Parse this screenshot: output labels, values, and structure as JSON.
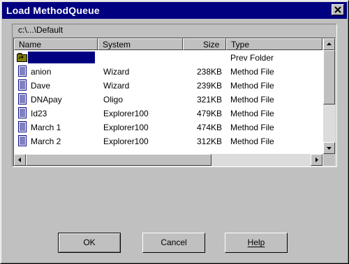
{
  "window": {
    "title": "Load MethodQueue"
  },
  "path_label": "c:\\...\\Default",
  "columns": {
    "name": "Name",
    "system": "System",
    "size": "Size",
    "type": "Type"
  },
  "rows": [
    {
      "name": "",
      "system": "",
      "size": "",
      "type": "Prev Folder",
      "icon": "folder-up-icon",
      "selected": true
    },
    {
      "name": "anion",
      "system": "Wizard",
      "size": "238KB",
      "type": "Method File",
      "icon": "file-icon"
    },
    {
      "name": "Dave",
      "system": "Wizard",
      "size": "239KB",
      "type": "Method File",
      "icon": "file-icon"
    },
    {
      "name": "DNApay",
      "system": "Oligo",
      "size": "321KB",
      "type": "Method File",
      "icon": "file-icon"
    },
    {
      "name": "Id23",
      "system": "Explorer100",
      "size": "479KB",
      "type": "Method File",
      "icon": "file-icon"
    },
    {
      "name": "March 1",
      "system": "Explorer100",
      "size": "474KB",
      "type": "Method File",
      "icon": "file-icon"
    },
    {
      "name": "March 2",
      "system": "Explorer100",
      "size": "312KB",
      "type": "Method File",
      "icon": "file-icon"
    }
  ],
  "buttons": {
    "ok": "OK",
    "cancel": "Cancel",
    "help": "Help"
  },
  "colors": {
    "title_bar": "#000080",
    "dialog_bg": "#c0c0c0",
    "selection": "#000080"
  }
}
